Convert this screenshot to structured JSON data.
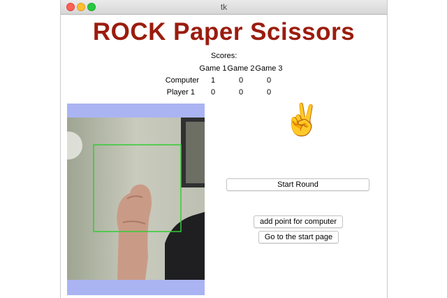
{
  "window": {
    "title": "tk"
  },
  "app": {
    "title": "ROCK Paper Scissors"
  },
  "scores": {
    "label": "Scores:",
    "columns": [
      "Game 1",
      "Game 2",
      "Game 3"
    ],
    "rows": [
      {
        "name": "Computer",
        "values": [
          "1",
          "0",
          "0"
        ]
      },
      {
        "name": "Player 1",
        "values": [
          "0",
          "0",
          "0"
        ]
      }
    ]
  },
  "computer_move": {
    "emoji": "✌️",
    "icon": "victory-hand-icon"
  },
  "buttons": {
    "start_round": "Start Round",
    "add_point": "add point for computer",
    "go_start": "Go to the start page"
  },
  "colors": {
    "title": "#9b1c0e",
    "camera_bg": "#aab4f2",
    "detect_box": "#33cc33"
  }
}
